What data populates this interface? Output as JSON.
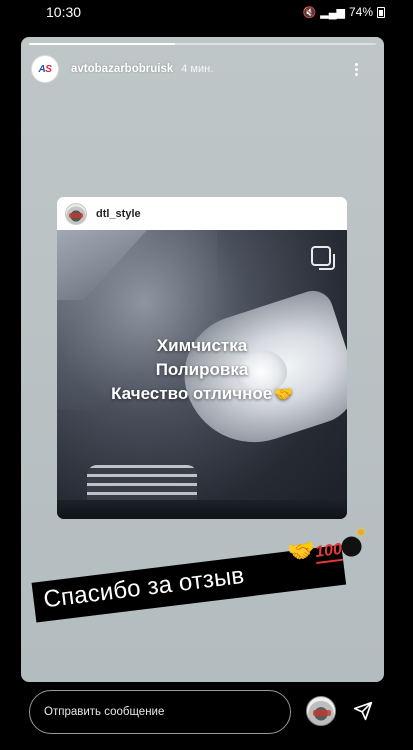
{
  "status_bar": {
    "time": "10:30",
    "battery": "74%",
    "icons": [
      "mute-icon",
      "volte-icon",
      "signal-icon",
      "battery-icon"
    ]
  },
  "story": {
    "progress": 0.42,
    "username": "avtobazarbobruisk",
    "time": "4 мин.",
    "avatar_logo": "AS"
  },
  "shared_post": {
    "username": "dtl_style",
    "caption_lines": [
      "Химчистка",
      "Полировка",
      "Качество отличное"
    ],
    "caption_emoji": "🤝"
  },
  "sticker_text": {
    "text": "Спасибо за отзыв",
    "emoji_handshake": "🤝",
    "emoji_hundred": "100"
  },
  "reply": {
    "placeholder": "Отправить сообщение"
  },
  "colors": {
    "story_background": "#bac2c4",
    "text": "#ffffff",
    "hundred_red": "#e53935"
  }
}
